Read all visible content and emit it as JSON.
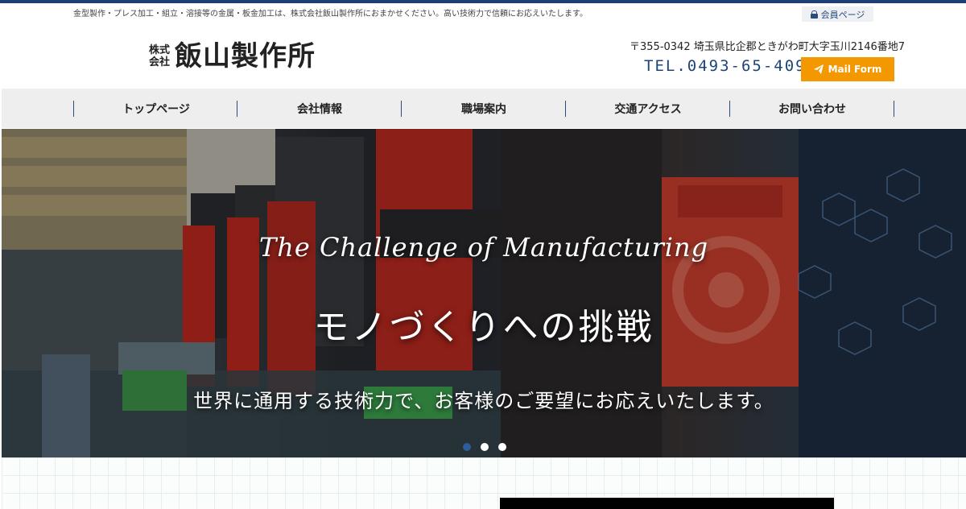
{
  "header": {
    "tagline": "金型製作・プレス加工・組立・溶接等の金属・板金加工は、株式会社飯山製作所におまかせください。高い技術力で信頼にお応えいたします。",
    "member_label": "会員ページ",
    "logo_small_1": "株式",
    "logo_small_2": "会社",
    "logo_main": "飯山製作所",
    "address": "〒355-0342 埼玉県比企郡ときがわ町大字玉川2146番地7",
    "tel": "TEL.0493-65-4099",
    "mail_label": "Mail Form"
  },
  "nav": {
    "items": [
      {
        "label": "トップページ"
      },
      {
        "label": "会社情報"
      },
      {
        "label": "職場案内"
      },
      {
        "label": "交通アクセス"
      },
      {
        "label": "お問い合わせ"
      }
    ]
  },
  "hero": {
    "challenge": "The Challenge of Manufacturing",
    "catch": "モノづくりへの挑戦",
    "sub": "世界に通用する技術力で、お客様のご要望にお応えいたします。",
    "slides": 3,
    "active_slide": 1
  },
  "colors": {
    "accent_navy": "#1d3f76",
    "mail_orange": "#f39800"
  }
}
